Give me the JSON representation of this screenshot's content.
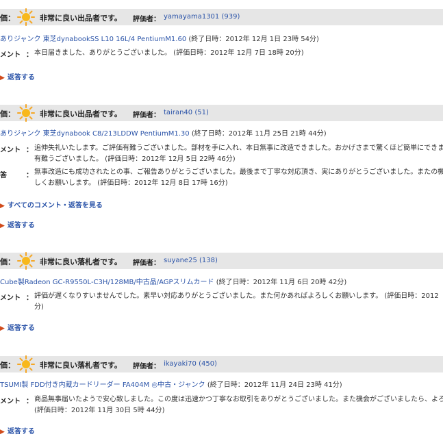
{
  "colors": {
    "accent": "#2a53a8",
    "header_bg": "#e6e6e6",
    "sun": "#f5a623"
  },
  "icons": {
    "rating": "sun-icon",
    "arrow": "triangle-right-icon"
  },
  "reviews": [
    {
      "label": "価：",
      "rating": "非常に良い出品者です。",
      "rater_label": "評価者：",
      "user": "yamayama1301",
      "count": "(939)",
      "item": "ありジャンク 東芝dynabookSS L10 16L/4 PentiumM1.60",
      "end_time": "(終了日時：2012年 12月 1日 23時 54分)",
      "comment_label": "メント",
      "comment_lines": [
        "本日届きました、ありがとうございました。 (評価日時：2012年 12月 7日 18時 20分)"
      ],
      "reply_link": "返答する"
    },
    {
      "label": "価：",
      "rating": "非常に良い出品者です。",
      "rater_label": "評価者：",
      "user": "tairan40",
      "count": "(51)",
      "item": "ありジャンク 東芝dynabook C8/213LDDW PentiumM1.30",
      "end_time": "(終了日時：2012年 11月 25日 21時 44分)",
      "comment_label": "メント",
      "comment_lines": [
        "追伸失礼いたします。ご評価有難うございました。部材を手に入れ、本日無事に改造できました。おかげさまで驚くほど簡単にできま",
        "有難うございました。 (評価日時：2012年 12月 5日 22時 46分)"
      ],
      "answer_label": "答",
      "answer_lines": [
        "無事改造にも成功されたとの事、ご報告ありがとうございました。最後まで丁寧な対応頂き、実にありがとうございました。またの機",
        "しくお願いします。 (評価日時：2012年 12月 8日 17時 16分)"
      ],
      "all_comments_link": "すべてのコメント・返答を見る",
      "reply_link": "返答する"
    },
    {
      "label": "価：",
      "rating": "非常に良い落札者です。",
      "rater_label": "評価者：",
      "user": "suyane25",
      "count": "(138)",
      "item": "Cube製Radeon GC-R9550L-C3H/128MB/中古品/AGPスリムカード",
      "end_time": "(終了日時：2012年 11月 6日 20時 42分)",
      "comment_label": "メント",
      "comment_lines": [
        "評価が遅くなりすいませんでした。素早い対応ありがとうございました。また何かあればよろしくお願いします。 (評価日時：2012",
        "分)"
      ],
      "reply_link": "返答する"
    },
    {
      "label": "価：",
      "rating": "非常に良い落札者です。",
      "rater_label": "評価者：",
      "user": "ikayaki70",
      "count": "(450)",
      "item": "TSUMI製 FDD付き内蔵カードリーダー FA404M ◎中古・ジャンク",
      "end_time": "(終了日時：2012年 11月 24日 23時 41分)",
      "comment_label": "メント",
      "comment_lines": [
        "商品無事届いたようで安心致しました。この度は迅速かつ丁寧なお取引をありがとうございました。また機会がございましたら、よろ",
        "(評価日時：2012年 11月 30日 5時 44分)"
      ],
      "reply_link": "返答する"
    }
  ]
}
